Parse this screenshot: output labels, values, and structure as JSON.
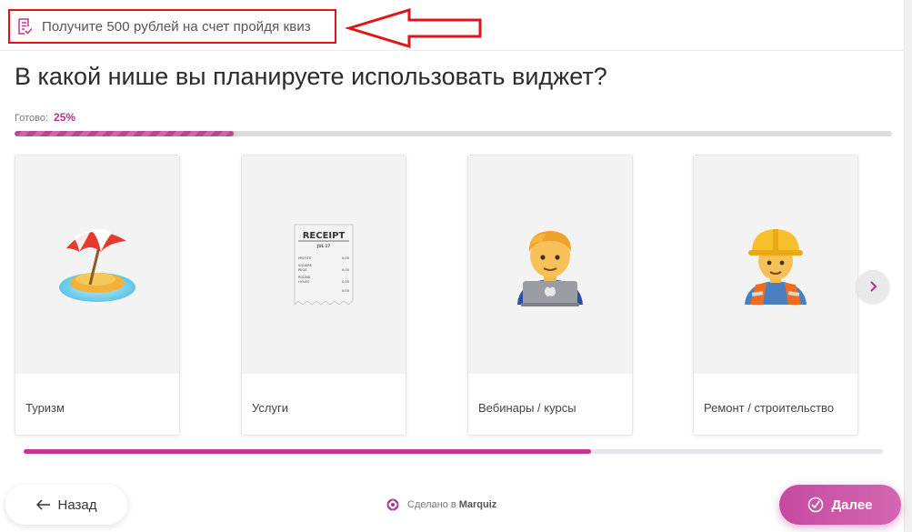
{
  "promo": {
    "text": "Получите 500 рублей на счет пройдя квиз"
  },
  "quiz": {
    "question": "В какой нише вы планируете использовать виджет?",
    "progress": {
      "label": "Готово:",
      "value_text": "25%",
      "fraction": 0.25
    }
  },
  "cards": [
    {
      "label": "Туризм",
      "icon": "beach-umbrella-icon"
    },
    {
      "label": "Услуги",
      "icon": "receipt-icon"
    },
    {
      "label": "Вебинары / курсы",
      "icon": "man-technologist-icon"
    },
    {
      "label": "Ремонт / строительство",
      "icon": "construction-worker-icon"
    }
  ],
  "receipt": {
    "title": "RECEIPT",
    "date": "JUL 17",
    "lines": [
      {
        "name": "MISFITS",
        "value": "0.00"
      },
      {
        "name": "SQUARE",
        "value": ""
      },
      {
        "name": "PEGS",
        "value": "0.00"
      },
      {
        "name": "ROUND",
        "value": ""
      },
      {
        "name": "HOLES",
        "value": "0.00"
      },
      {
        "name": "",
        "value": "0.00"
      }
    ]
  },
  "carousel": {
    "scroll_fraction": 0.66
  },
  "footer": {
    "back_label": "Назад",
    "credit_prefix": "Сделано в",
    "credit_brand": "Marquiz",
    "next_label": "Далее"
  },
  "colors": {
    "accent": "#c5358f",
    "promo_border": "#e0141b"
  }
}
